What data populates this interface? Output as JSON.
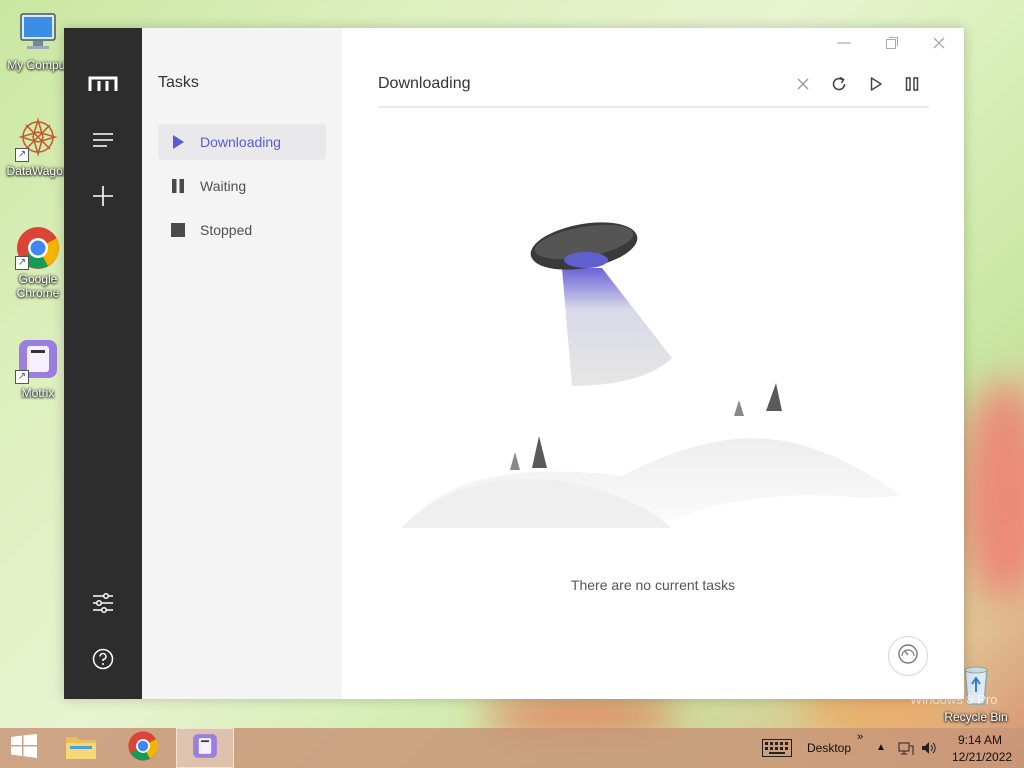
{
  "desktop": {
    "icons": [
      {
        "label": "My Comput",
        "icon": "computer-icon"
      },
      {
        "label": "DataWagon",
        "icon": "datawagon-icon"
      },
      {
        "label": "Google Chrome",
        "icon": "chrome-icon"
      },
      {
        "label": "Motrix",
        "icon": "motrix-icon"
      },
      {
        "label": "Recycle Bin",
        "icon": "recycle-bin-icon"
      }
    ],
    "watermark": "Windows 8 Pro"
  },
  "app": {
    "name": "Motrix",
    "sidebar": {
      "icons": [
        "motrix-logo-icon",
        "menu-icon",
        "add-icon",
        "preferences-icon",
        "help-icon"
      ]
    },
    "subnav": {
      "title": "Tasks",
      "items": [
        {
          "label": "Downloading",
          "icon": "play-icon",
          "active": true
        },
        {
          "label": "Waiting",
          "icon": "pause-icon",
          "active": false
        },
        {
          "label": "Stopped",
          "icon": "stop-icon",
          "active": false
        }
      ]
    },
    "main": {
      "title": "Downloading",
      "toolbar": [
        "close-icon",
        "refresh-icon",
        "resume-all-icon",
        "pause-all-icon"
      ],
      "empty_message": "There are no current tasks"
    },
    "accent_color": "#5b5bd6"
  },
  "taskbar": {
    "desktop_label": "Desktop",
    "chevron": "»",
    "time": "9:14 AM",
    "date": "12/21/2022"
  }
}
